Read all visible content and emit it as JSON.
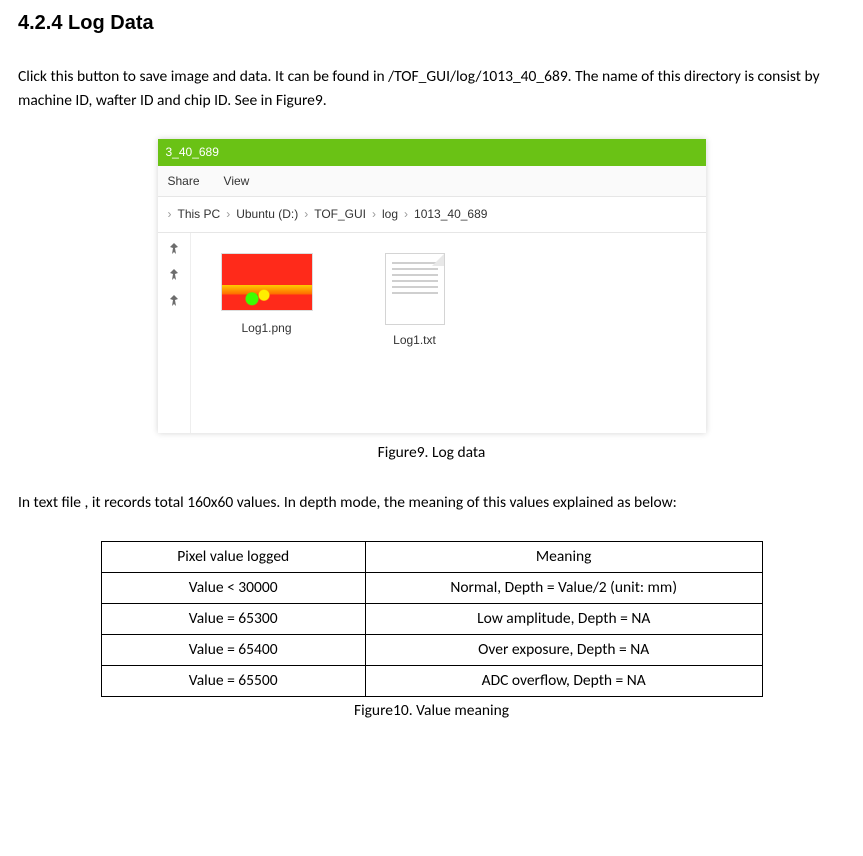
{
  "heading": "4.2.4 Log Data",
  "para1": "Click this button to save image and data. It can be found in /TOF_GUI/log/1013_40_689. The name of this directory is consist by machine ID, wafter ID and chip ID. See in Figure9.",
  "figure9_caption": "Figure9. Log data",
  "para2": "In text file , it records total 160x60 values. In depth mode, the meaning of this values explained as below:",
  "figure10_caption": "Figure10. Value meaning",
  "explorer": {
    "title": "3_40_689",
    "tabs": {
      "share": "Share",
      "view": "View"
    },
    "path": [
      "This PC",
      "Ubuntu (D:)",
      "TOF_GUI",
      "log",
      "1013_40_689"
    ],
    "files": {
      "png": "Log1.png",
      "txt": "Log1.txt"
    }
  },
  "chart_data": {
    "type": "table",
    "title": "Value meaning",
    "headers": [
      "Pixel value logged",
      "Meaning"
    ],
    "rows": [
      [
        "Value < 30000",
        "Normal, Depth = Value/2 (unit: mm)"
      ],
      [
        "Value = 65300",
        "Low amplitude, Depth = NA"
      ],
      [
        "Value = 65400",
        "Over exposure, Depth = NA"
      ],
      [
        "Value = 65500",
        "ADC overflow, Depth = NA"
      ]
    ]
  }
}
